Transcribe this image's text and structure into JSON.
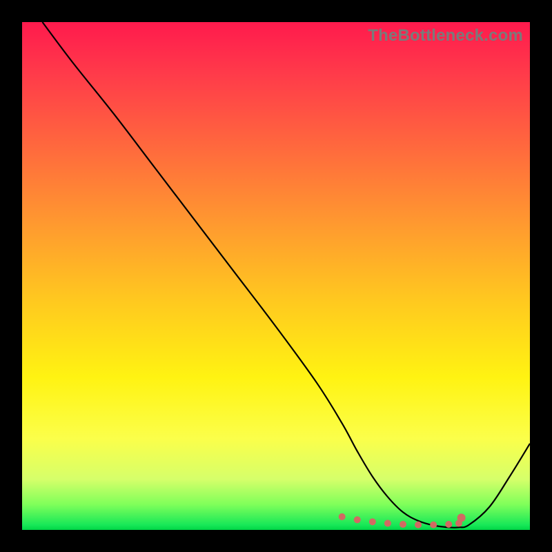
{
  "watermark": "TheBottleneck.com",
  "chart_data": {
    "type": "line",
    "title": "",
    "xlabel": "",
    "ylabel": "",
    "xlim": [
      0,
      100
    ],
    "ylim": [
      0,
      100
    ],
    "x": [
      4,
      10,
      18,
      26,
      34,
      42,
      50,
      58,
      63,
      66,
      69,
      72,
      75,
      78,
      81,
      84,
      86,
      88,
      92,
      96,
      100
    ],
    "values": [
      100,
      92,
      82,
      71.5,
      61,
      50.5,
      40,
      29,
      21,
      15.5,
      10.5,
      6.5,
      3.5,
      1.8,
      0.9,
      0.5,
      0.5,
      1.0,
      4.5,
      10.5,
      17
    ],
    "flat_region_x": [
      63,
      66,
      69,
      72,
      75,
      78,
      81,
      84,
      86
    ],
    "flat_region_y": [
      2.6,
      2.0,
      1.6,
      1.3,
      1.1,
      1.0,
      1.0,
      1.1,
      1.3
    ],
    "end_dot": {
      "x": 86.5,
      "y": 2.4
    }
  }
}
